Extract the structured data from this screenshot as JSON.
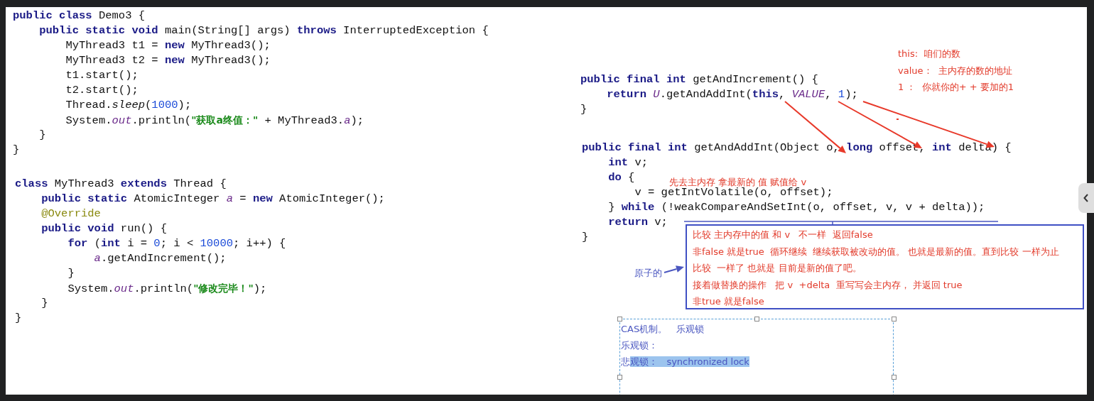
{
  "left_code": [
    {
      "lines": [
        [
          {
            "kind": "keyword",
            "text": "public class"
          },
          {
            "kind": "plain",
            "text": " Demo3 {"
          }
        ],
        [
          {
            "kind": "keyword",
            "text": "    public static void"
          },
          {
            "kind": "plain",
            "text": " main(String[] args) "
          },
          {
            "kind": "keyword",
            "text": "throws"
          },
          {
            "kind": "plain",
            "text": " InterruptedException {"
          }
        ],
        [
          {
            "kind": "plain",
            "text": "        MyThread3 t1 = "
          },
          {
            "kind": "keyword",
            "text": "new"
          },
          {
            "kind": "plain",
            "text": " MyThread3();"
          }
        ],
        [
          {
            "kind": "plain",
            "text": "        MyThread3 t2 = "
          },
          {
            "kind": "keyword",
            "text": "new"
          },
          {
            "kind": "plain",
            "text": " MyThread3();"
          }
        ],
        [
          {
            "kind": "plain",
            "text": "        t1.start();"
          }
        ],
        [
          {
            "kind": "plain",
            "text": "        t2.start();"
          }
        ],
        [
          {
            "kind": "plain",
            "text": "        Thread."
          },
          {
            "kind": "static_call",
            "text": "sleep"
          },
          {
            "kind": "plain",
            "text": "("
          },
          {
            "kind": "number",
            "text": "1000"
          },
          {
            "kind": "plain",
            "text": ");"
          }
        ],
        [
          {
            "kind": "plain",
            "text": "        System."
          },
          {
            "kind": "field",
            "text": "out"
          },
          {
            "kind": "plain",
            "text": ".println("
          },
          {
            "kind": "string",
            "text": "\"获取a终值：\""
          },
          {
            "kind": "plain",
            "text": " + MyThread3."
          },
          {
            "kind": "field",
            "text": "a"
          },
          {
            "kind": "plain",
            "text": ");"
          }
        ],
        [
          {
            "kind": "plain",
            "text": "    }"
          }
        ],
        [
          {
            "kind": "plain",
            "text": "}"
          }
        ]
      ]
    },
    {
      "lines": [
        [
          {
            "kind": "keyword",
            "text": "class"
          },
          {
            "kind": "plain",
            "text": " MyThread3 "
          },
          {
            "kind": "keyword",
            "text": "extends"
          },
          {
            "kind": "plain",
            "text": " Thread {"
          }
        ],
        [
          {
            "kind": "keyword",
            "text": "    public static"
          },
          {
            "kind": "plain",
            "text": " AtomicInteger "
          },
          {
            "kind": "field",
            "text": "a"
          },
          {
            "kind": "plain",
            "text": " = "
          },
          {
            "kind": "keyword",
            "text": "new"
          },
          {
            "kind": "plain",
            "text": " AtomicInteger();"
          }
        ],
        [
          {
            "kind": "annotation",
            "text": "    @Override"
          }
        ],
        [
          {
            "kind": "keyword",
            "text": "    public void"
          },
          {
            "kind": "plain",
            "text": " run() {"
          }
        ],
        [
          {
            "kind": "keyword",
            "text": "        for"
          },
          {
            "kind": "plain",
            "text": " ("
          },
          {
            "kind": "keyword",
            "text": "int"
          },
          {
            "kind": "plain",
            "text": " i = "
          },
          {
            "kind": "number",
            "text": "0"
          },
          {
            "kind": "plain",
            "text": "; i < "
          },
          {
            "kind": "number",
            "text": "10000"
          },
          {
            "kind": "plain",
            "text": "; i++) {"
          }
        ],
        [
          {
            "kind": "field",
            "text": "            a"
          },
          {
            "kind": "plain",
            "text": ".getAndIncrement();"
          }
        ],
        [
          {
            "kind": "plain",
            "text": "        }"
          }
        ],
        [
          {
            "kind": "plain",
            "text": "        System."
          },
          {
            "kind": "field",
            "text": "out"
          },
          {
            "kind": "plain",
            "text": ".println("
          },
          {
            "kind": "string",
            "text": "\"修改完毕！\""
          },
          {
            "kind": "plain",
            "text": ");"
          }
        ],
        [
          {
            "kind": "plain",
            "text": "    }"
          }
        ],
        [
          {
            "kind": "plain",
            "text": "}"
          }
        ]
      ]
    }
  ],
  "right_code": [
    {
      "lines": [
        [
          {
            "kind": "keyword",
            "text": "public final int"
          },
          {
            "kind": "plain",
            "text": " getAndIncrement() {"
          }
        ],
        [
          {
            "kind": "keyword",
            "text": "    return"
          },
          {
            "kind": "field",
            "text": " U"
          },
          {
            "kind": "plain",
            "text": ".getAndAddInt("
          },
          {
            "kind": "keyword",
            "text": "this"
          },
          {
            "kind": "plain",
            "text": ", "
          },
          {
            "kind": "field",
            "text": "VALUE"
          },
          {
            "kind": "plain",
            "text": ", "
          },
          {
            "kind": "number",
            "text": "1"
          },
          {
            "kind": "plain",
            "text": ");"
          }
        ],
        [
          {
            "kind": "plain",
            "text": "}"
          }
        ]
      ]
    },
    {
      "lines": [
        [
          {
            "kind": "keyword",
            "text": "public final int"
          },
          {
            "kind": "plain",
            "text": " getAndAddInt(Object o, "
          },
          {
            "kind": "keyword",
            "text": "long"
          },
          {
            "kind": "plain",
            "text": " offset, "
          },
          {
            "kind": "keyword",
            "text": "int"
          },
          {
            "kind": "plain",
            "text": " delta) {"
          }
        ],
        [
          {
            "kind": "keyword",
            "text": "    int"
          },
          {
            "kind": "plain",
            "text": " v;"
          }
        ],
        [
          {
            "kind": "keyword",
            "text": "    do"
          },
          {
            "kind": "plain",
            "text": " {"
          }
        ],
        [
          {
            "kind": "plain",
            "text": "        v = getIntVolatile(o, offset);"
          }
        ],
        [
          {
            "kind": "plain",
            "text": "    } "
          },
          {
            "kind": "keyword",
            "text": "while"
          },
          {
            "kind": "plain",
            "text": " (!weakCompareAndSetInt(o, offset, v, v + delta));"
          }
        ],
        [
          {
            "kind": "keyword",
            "text": "    return"
          },
          {
            "kind": "plain",
            "text": " v;"
          }
        ],
        [
          {
            "kind": "plain",
            "text": "}"
          }
        ]
      ]
    }
  ],
  "param_notes": [
    "this:  咱们的数",
    "value：  主内存的数的地址",
    "1 ：  你就你的+ + 要加的1"
  ],
  "do_note": "先去主内存 拿最新的 值 赋值给 v",
  "compare_box": [
    "比较 主内存中的值 和 v   不一样  返回false",
    "非false 就是true  循环继续  继续获取被改动的值。 也就是最新的值。直到比较 一样为止",
    "比较  一样了 也就是 目前是新的值了吧。",
    "接着做替换的操作   把 v  +delta  重写写会主内存， 并返回 true",
    "非true 就是false"
  ],
  "atomic_label": "原子的",
  "text_box": [
    {
      "segments": [
        {
          "text": "CAS机制。   乐观锁",
          "selected": false
        }
      ]
    },
    {
      "segments": [
        {
          "text": "乐观锁：",
          "selected": false
        }
      ]
    },
    {
      "segments": [
        {
          "text": "悲",
          "selected": false
        },
        {
          "text": "观锁：   synchronized lock",
          "selected": true
        }
      ]
    }
  ]
}
